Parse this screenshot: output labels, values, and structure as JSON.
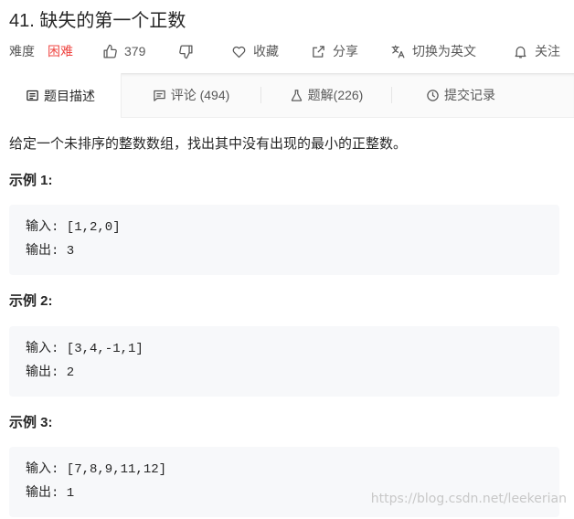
{
  "problem": {
    "title": "41. 缺失的第一个正数"
  },
  "meta": {
    "difficulty_label": "难度",
    "difficulty_value": "困难",
    "likes": "379",
    "favorite_label": "收藏",
    "share_label": "分享",
    "switch_lang_label": "切换为英文",
    "follow_label": "关注"
  },
  "tabs": [
    {
      "label": "题目描述",
      "icon": "document-icon"
    },
    {
      "label": "评论 (494)",
      "icon": "comment-icon"
    },
    {
      "label": "题解(226)",
      "icon": "flask-icon"
    },
    {
      "label": "提交记录",
      "icon": "clock-icon"
    }
  ],
  "content": {
    "description": "给定一个未排序的整数数组，找出其中没有出现的最小的正整数。",
    "examples": [
      {
        "title": "示例 1:",
        "input": "输入: [1,2,0]",
        "output": "输出: 3"
      },
      {
        "title": "示例 2:",
        "input": "输入: [3,4,-1,1]",
        "output": "输出: 2"
      },
      {
        "title": "示例 3:",
        "input": "输入: [7,8,9,11,12]",
        "output": "输出: 1"
      }
    ]
  },
  "watermark": "https://blog.csdn.net/leekerian",
  "colors": {
    "hard": "#ef4743",
    "text": "#262626",
    "muted": "#595959",
    "code_bg": "#f7f8fa"
  }
}
